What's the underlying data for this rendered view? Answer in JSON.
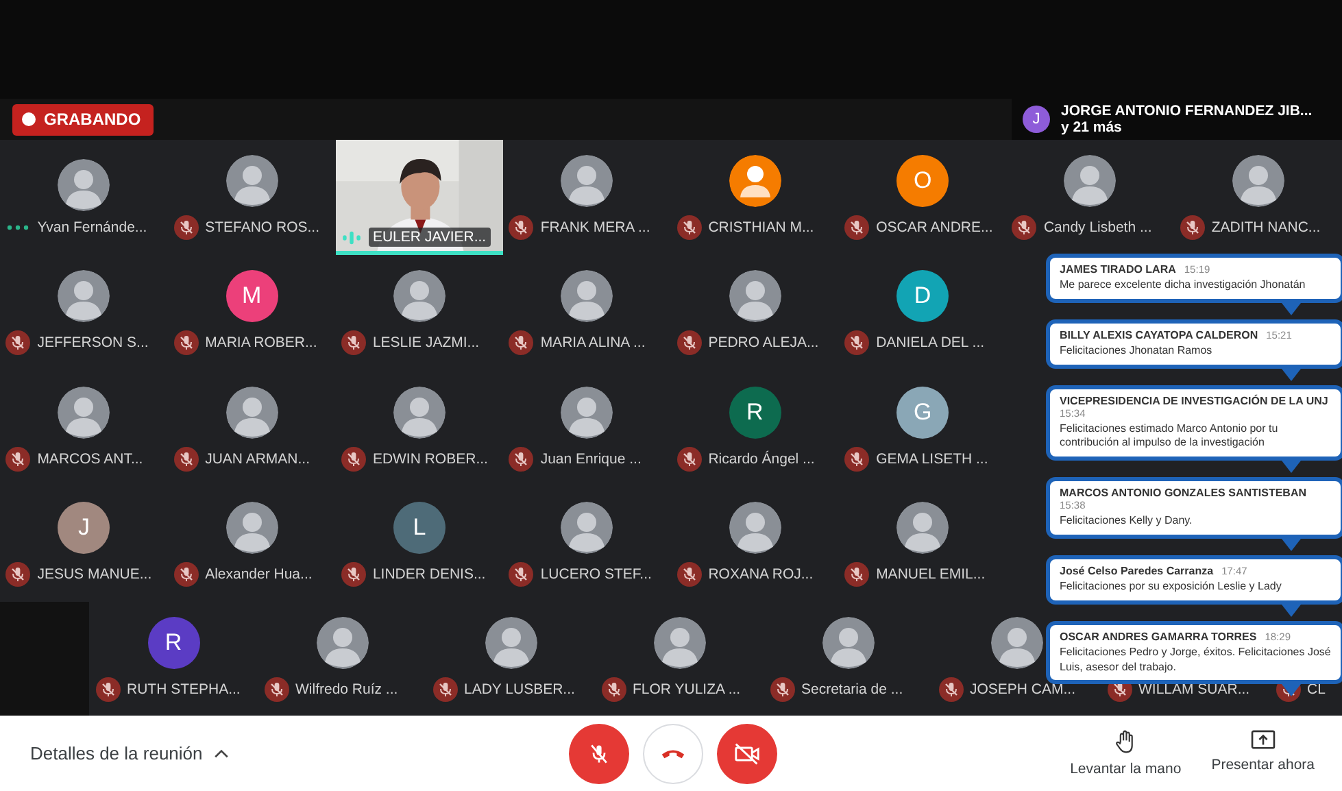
{
  "recording": {
    "label": "GRABANDO"
  },
  "presenter": {
    "letter": "J",
    "color": "#8e5cd9",
    "name": "JORGE ANTONIO FERNANDEZ JIB...",
    "more": "y 21 más"
  },
  "grid_rows": [
    [
      {
        "name": "Yvan Fernánde...",
        "muted": false,
        "speaking": false
      },
      {
        "name": "STEFANO ROS...",
        "muted": true,
        "speaking": false
      },
      {
        "name": "EULER JAVIER...",
        "avatar": {
          "kind": "video"
        },
        "muted": false,
        "speaking": true
      },
      {
        "name": "FRANK MERA ...",
        "muted": true,
        "speaking": false
      },
      {
        "name": "CRISTHIAN M...",
        "avatar": {
          "kind": "person",
          "color": "#f57c00"
        },
        "muted": true,
        "speaking": false
      },
      {
        "name": "OSCAR ANDRE...",
        "avatar": {
          "kind": "letter",
          "letter": "O",
          "color": "#f57c00"
        },
        "muted": true,
        "speaking": false
      },
      {
        "name": "Candy Lisbeth ...",
        "muted": true,
        "speaking": false
      },
      {
        "name": "ZADITH NANC...",
        "muted": true,
        "speaking": false
      }
    ],
    [
      {
        "name": "JEFFERSON S...",
        "muted": true,
        "speaking": false
      },
      {
        "name": "MARIA ROBER...",
        "avatar": {
          "kind": "letter",
          "letter": "M",
          "color": "#ec407a"
        },
        "muted": true,
        "speaking": false
      },
      {
        "name": "LESLIE JAZMI...",
        "muted": true,
        "speaking": false
      },
      {
        "name": "MARIA ALINA ...",
        "muted": true,
        "speaking": false
      },
      {
        "name": "PEDRO ALEJA...",
        "muted": true,
        "speaking": false
      },
      {
        "name": "DANIELA DEL ...",
        "avatar": {
          "kind": "letter",
          "letter": "D",
          "color": "#12a4b4"
        },
        "muted": true,
        "speaking": false
      }
    ],
    [
      {
        "name": "MARCOS ANT...",
        "muted": true,
        "speaking": false
      },
      {
        "name": "JUAN ARMAN...",
        "muted": true,
        "speaking": false
      },
      {
        "name": "EDWIN ROBER...",
        "muted": true,
        "speaking": false
      },
      {
        "name": "Juan Enrique ...",
        "muted": true,
        "speaking": false
      },
      {
        "name": "Ricardo Ángel ...",
        "avatar": {
          "kind": "letter",
          "letter": "R",
          "color": "#0d6b4f"
        },
        "muted": true,
        "speaking": false
      },
      {
        "name": "GEMA LISETH ...",
        "avatar": {
          "kind": "letter",
          "letter": "G",
          "color": "#8aa7b6"
        },
        "muted": true,
        "speaking": false
      }
    ],
    [
      {
        "name": "JESUS MANUE...",
        "avatar": {
          "kind": "letter",
          "letter": "J",
          "color": "#a1887f"
        },
        "muted": true,
        "speaking": false
      },
      {
        "name": "Alexander Hua...",
        "muted": true,
        "speaking": false
      },
      {
        "name": "LINDER DENIS...",
        "avatar": {
          "kind": "letter",
          "letter": "L",
          "color": "#4e6b78"
        },
        "muted": true,
        "speaking": false
      },
      {
        "name": "LUCERO STEF...",
        "muted": true,
        "speaking": false
      },
      {
        "name": "ROXANA ROJ...",
        "muted": true,
        "speaking": false
      },
      {
        "name": "MANUEL EMIL...",
        "muted": true,
        "speaking": false
      }
    ]
  ],
  "bottom_row": [
    {
      "name": "RUTH STEPHA...",
      "avatar": {
        "kind": "letter",
        "letter": "R",
        "color": "#5b3cc4"
      },
      "muted": true
    },
    {
      "name": "Wilfredo Ruíz ...",
      "muted": true
    },
    {
      "name": "LADY LUSBER...",
      "muted": true
    },
    {
      "name": "FLOR YULIZA ...",
      "muted": true
    },
    {
      "name": "Secretaria de ...",
      "muted": true
    },
    {
      "name": "JOSEPH CAM...",
      "muted": true
    },
    {
      "name": "WILLAM SUAR...",
      "avatar": {
        "kind": "hidden"
      },
      "muted": true
    },
    {
      "name": "CL",
      "avatar": {
        "kind": "hidden"
      },
      "muted": true
    }
  ],
  "chat_messages": [
    {
      "sender": "JAMES TIRADO LARA",
      "time": "15:19",
      "text": "Me parece excelente dicha investigación Jhonatán"
    },
    {
      "sender": "BILLY ALEXIS CAYATOPA CALDERON",
      "time": "15:21",
      "text": "Felicitaciones Jhonatan Ramos"
    },
    {
      "sender": "VICEPRESIDENCIA DE INVESTIGACIÓN DE LA UNJ",
      "time": "15:34",
      "text": "Felicitaciones estimado Marco Antonio por tu contribución al impulso de la investigación"
    },
    {
      "sender": "MARCOS ANTONIO GONZALES SANTISTEBAN",
      "time": "15:38",
      "text": "Felicitaciones Kelly y Dany."
    },
    {
      "sender": "José Celso Paredes Carranza",
      "time": "17:47",
      "text": "Felicitaciones por su exposición Leslie y Lady"
    },
    {
      "sender": "OSCAR ANDRES GAMARRA TORRES",
      "time": "18:29",
      "text": "Felicitaciones Pedro y Jorge, éxitos. Felicitaciones José Luis, asesor del trabajo."
    }
  ],
  "toolbar": {
    "details": "Detalles de la reunión",
    "raise_hand": "Levantar la mano",
    "present": "Presentar ahora"
  }
}
